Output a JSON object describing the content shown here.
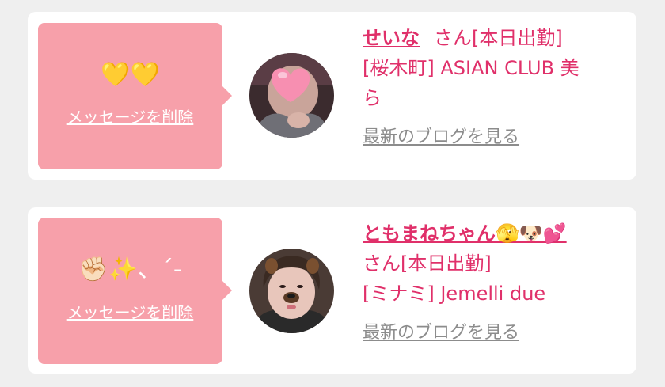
{
  "cards": [
    {
      "bubble_emoji": "💛💛",
      "delete_label": "メッセージを削除",
      "name": "せいな",
      "suffix": "さん[本日出勤]",
      "shop_line1": "[桜木町] ASIAN CLUB 美",
      "shop_line2": "ら",
      "blog_label": "最新のブログを見る"
    },
    {
      "bubble_emoji": "✊🏻✨、´-",
      "delete_label": "メッセージを削除",
      "name": "ともまねちゃん🫣🐶💕",
      "suffix": "さん[本日出勤]",
      "shop_line1": "[ミナミ] Jemelli due",
      "blog_label": "最新のブログを見る"
    }
  ],
  "colors": {
    "background": "#efefef",
    "bubble": "#f7a0aa",
    "accent": "#e0306a",
    "muted_link": "#8c8c8c"
  }
}
